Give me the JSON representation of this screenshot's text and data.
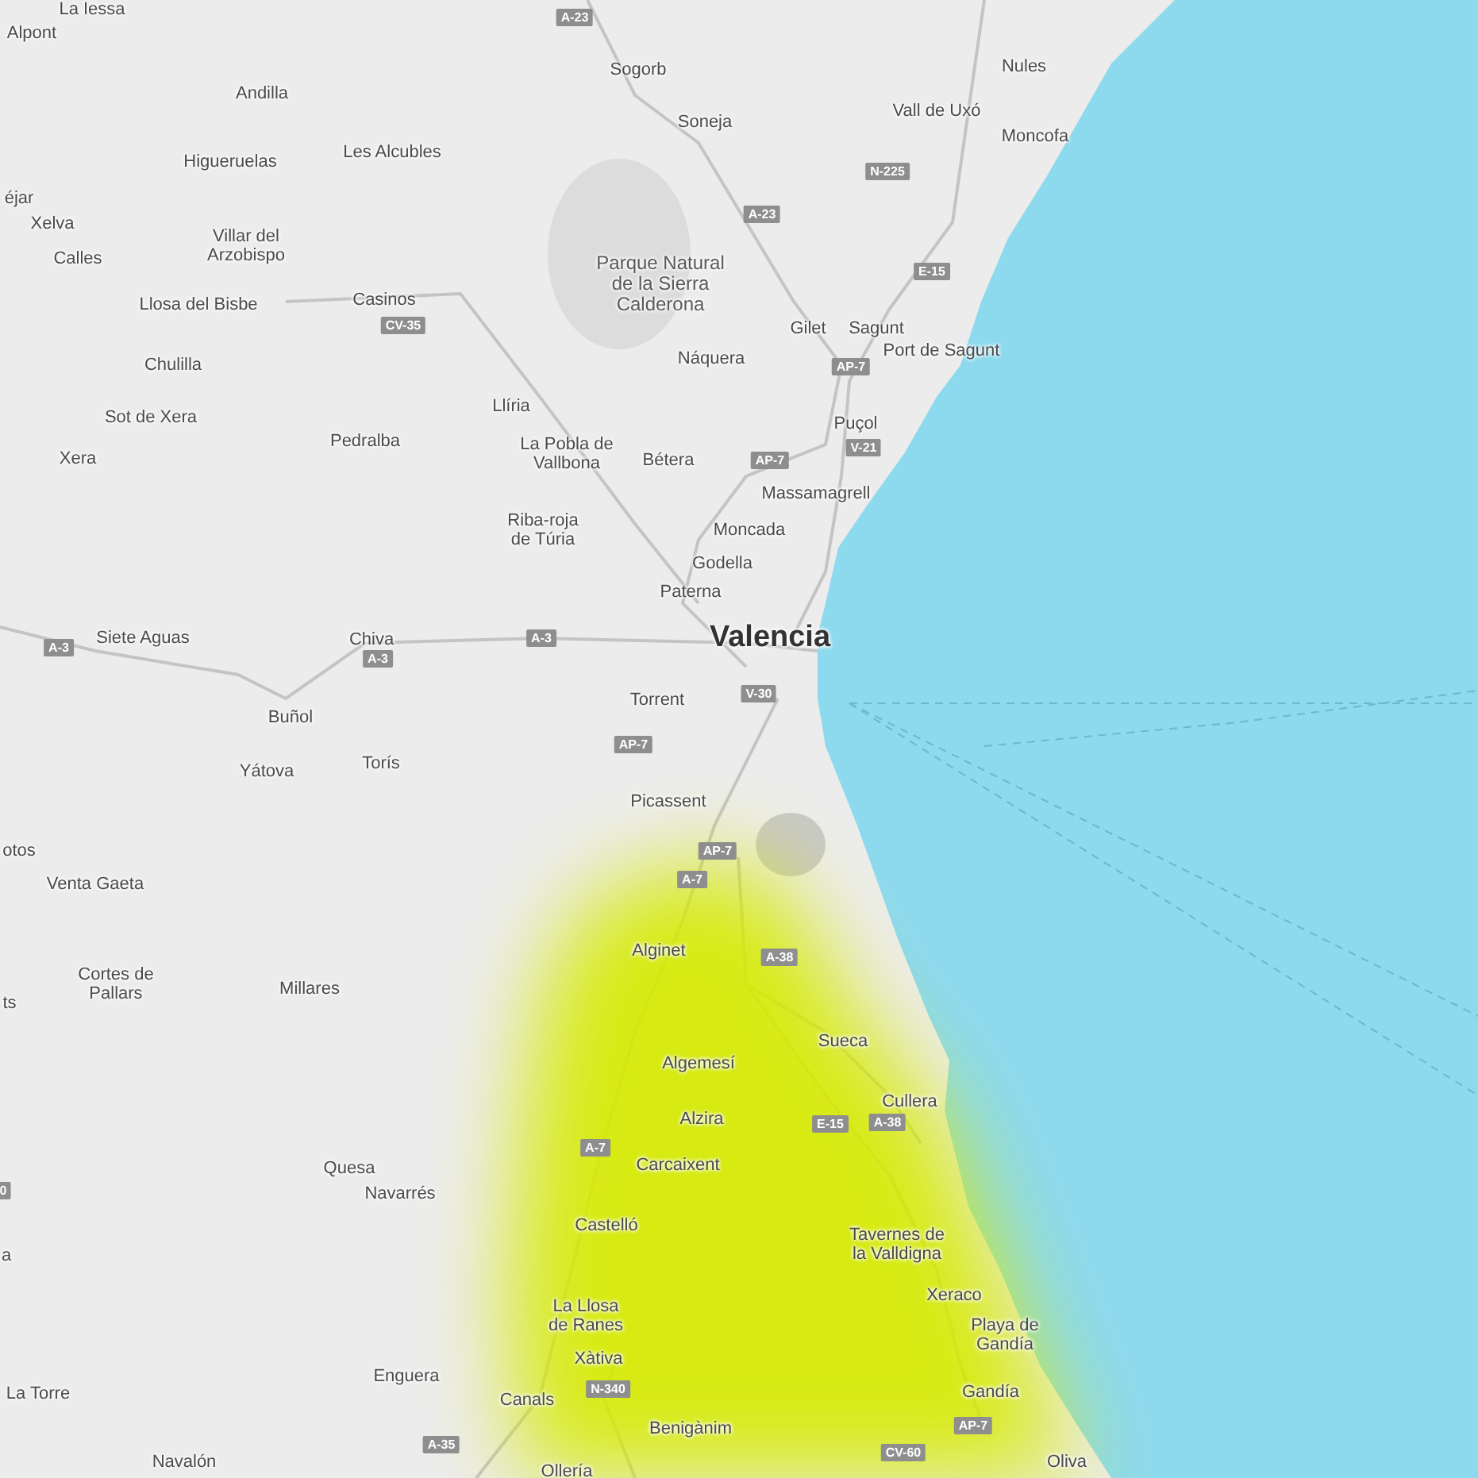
{
  "map": {
    "places": [
      {
        "name": "La Iessa",
        "kind": "town"
      },
      {
        "name": "Alpont",
        "kind": "town"
      },
      {
        "name": "Andilla",
        "kind": "town"
      },
      {
        "name": "Higueruelas",
        "kind": "town"
      },
      {
        "name": "Les Alcubles",
        "kind": "town"
      },
      {
        "name": "éjar",
        "kind": "town"
      },
      {
        "name": "Xelva",
        "kind": "town"
      },
      {
        "name": "Calles",
        "kind": "town"
      },
      {
        "name": "Villar del\nArzobispo",
        "kind": "town"
      },
      {
        "name": "Llosa del Bisbe",
        "kind": "town"
      },
      {
        "name": "Casinos",
        "kind": "town"
      },
      {
        "name": "Chulilla",
        "kind": "town"
      },
      {
        "name": "Sot de Xera",
        "kind": "town"
      },
      {
        "name": "Pedralba",
        "kind": "town"
      },
      {
        "name": "Xera",
        "kind": "town"
      },
      {
        "name": "Siete Aguas",
        "kind": "town"
      },
      {
        "name": "Chiva",
        "kind": "town"
      },
      {
        "name": "Buñol",
        "kind": "town"
      },
      {
        "name": "Yátova",
        "kind": "town"
      },
      {
        "name": "Torís",
        "kind": "town"
      },
      {
        "name": "otos",
        "kind": "town"
      },
      {
        "name": "Venta Gaeta",
        "kind": "town"
      },
      {
        "name": "Cortes de\nPallars",
        "kind": "town"
      },
      {
        "name": "ts",
        "kind": "town"
      },
      {
        "name": "Millares",
        "kind": "town"
      },
      {
        "name": "Quesa",
        "kind": "town"
      },
      {
        "name": "Navarrés",
        "kind": "town"
      },
      {
        "name": "a",
        "kind": "town"
      },
      {
        "name": "La Torre",
        "kind": "town"
      },
      {
        "name": "Enguera",
        "kind": "town"
      },
      {
        "name": "Navalón",
        "kind": "town"
      },
      {
        "name": "Sogorb",
        "kind": "town"
      },
      {
        "name": "Soneja",
        "kind": "town"
      },
      {
        "name": "Nules",
        "kind": "town"
      },
      {
        "name": "Vall de Uxó",
        "kind": "town"
      },
      {
        "name": "Moncofa",
        "kind": "town"
      },
      {
        "name": "Parque Natural\nde la Sierra\nCalderona",
        "kind": "park"
      },
      {
        "name": "Gilet",
        "kind": "town"
      },
      {
        "name": "Sagunt",
        "kind": "town"
      },
      {
        "name": "Port de Sagunt",
        "kind": "town"
      },
      {
        "name": "Náquera",
        "kind": "town"
      },
      {
        "name": "Llíria",
        "kind": "town"
      },
      {
        "name": "La Pobla de\nVallbona",
        "kind": "town"
      },
      {
        "name": "Bétera",
        "kind": "town"
      },
      {
        "name": "Puçol",
        "kind": "town"
      },
      {
        "name": "Massamagrell",
        "kind": "town"
      },
      {
        "name": "Riba-roja\nde Túria",
        "kind": "town"
      },
      {
        "name": "Moncada",
        "kind": "town"
      },
      {
        "name": "Godella",
        "kind": "town"
      },
      {
        "name": "Paterna",
        "kind": "town"
      },
      {
        "name": "Valencia",
        "kind": "city"
      },
      {
        "name": "Torrent",
        "kind": "town"
      },
      {
        "name": "Picassent",
        "kind": "town"
      },
      {
        "name": "Alginet",
        "kind": "town"
      },
      {
        "name": "Sueca",
        "kind": "town"
      },
      {
        "name": "Algemesí",
        "kind": "town"
      },
      {
        "name": "Cullera",
        "kind": "town"
      },
      {
        "name": "Alzira",
        "kind": "town"
      },
      {
        "name": "Carcaixent",
        "kind": "town"
      },
      {
        "name": "Castelló",
        "kind": "town"
      },
      {
        "name": "Tavernes de\nla Valldigna",
        "kind": "town"
      },
      {
        "name": "Xeraco",
        "kind": "town"
      },
      {
        "name": "Playa de\nGandía",
        "kind": "town"
      },
      {
        "name": "La Llosa\nde Ranes",
        "kind": "town"
      },
      {
        "name": "Xàtiva",
        "kind": "town"
      },
      {
        "name": "Canals",
        "kind": "town"
      },
      {
        "name": "Gandía",
        "kind": "town"
      },
      {
        "name": "Benigànim",
        "kind": "town"
      },
      {
        "name": "Ollería",
        "kind": "town"
      },
      {
        "name": "Oliva",
        "kind": "town"
      }
    ],
    "road_shields": [
      {
        "label": "A-23"
      },
      {
        "label": "N-225"
      },
      {
        "label": "A-23"
      },
      {
        "label": "E-15"
      },
      {
        "label": "CV-35"
      },
      {
        "label": "AP-7"
      },
      {
        "label": "V-21"
      },
      {
        "label": "AP-7"
      },
      {
        "label": "A-3"
      },
      {
        "label": "A-3"
      },
      {
        "label": "A-3"
      },
      {
        "label": "V-30"
      },
      {
        "label": "AP-7"
      },
      {
        "label": "AP-7"
      },
      {
        "label": "A-7"
      },
      {
        "label": "A-38"
      },
      {
        "label": "E-15"
      },
      {
        "label": "A-38"
      },
      {
        "label": "A-7"
      },
      {
        "label": "N-340"
      },
      {
        "label": "A-35"
      },
      {
        "label": "AP-7"
      },
      {
        "label": "CV-60"
      },
      {
        "label": "0"
      }
    ]
  }
}
